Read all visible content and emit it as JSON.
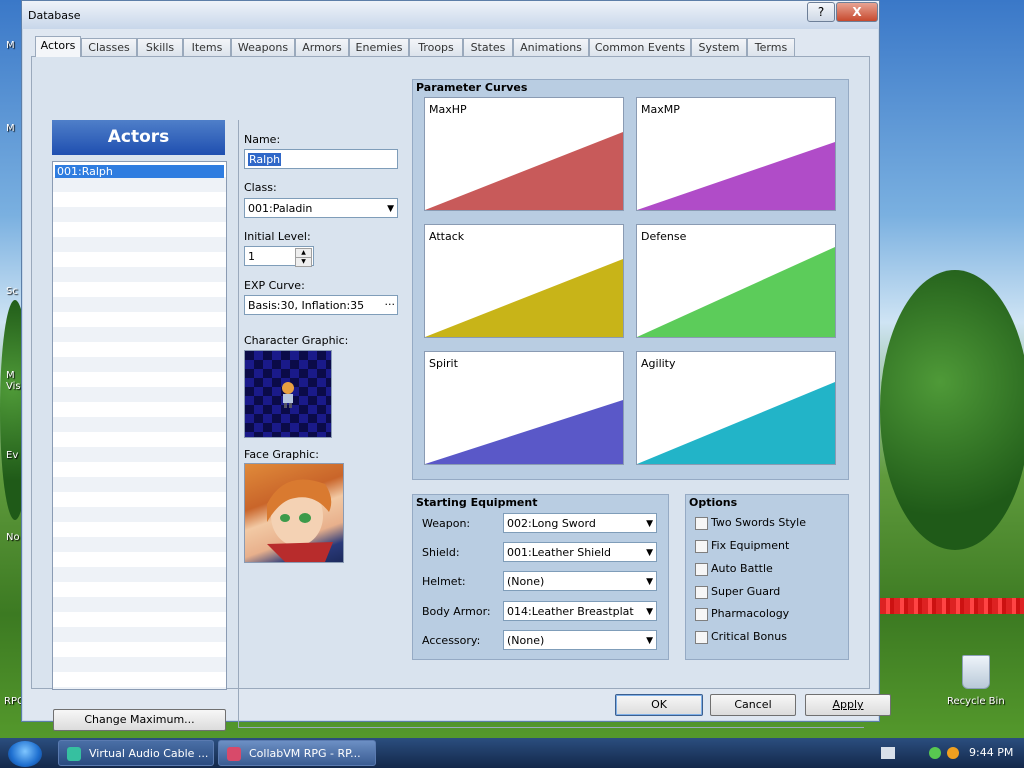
{
  "desktop": {
    "recycle_bin_label": "Recycle Bin",
    "edge_labels": [
      "M",
      "M",
      "Sc",
      "M",
      "Vis",
      "Ev",
      "No",
      "RPC"
    ]
  },
  "window": {
    "title": "Database",
    "help_label": "?",
    "close_label": "X"
  },
  "tabs": [
    {
      "label": "Actors",
      "active": true
    },
    {
      "label": "Classes"
    },
    {
      "label": "Skills"
    },
    {
      "label": "Items"
    },
    {
      "label": "Weapons"
    },
    {
      "label": "Armors"
    },
    {
      "label": "Enemies"
    },
    {
      "label": "Troops"
    },
    {
      "label": "States"
    },
    {
      "label": "Animations"
    },
    {
      "label": "Common Events"
    },
    {
      "label": "System"
    },
    {
      "label": "Terms"
    }
  ],
  "actors_list": {
    "header": "Actors",
    "items": [
      "001:Ralph"
    ],
    "change_max_label": "Change Maximum..."
  },
  "actor": {
    "name_label": "Name:",
    "name_value": "Ralph",
    "class_label": "Class:",
    "class_value": "001:Paladin",
    "level_label": "Initial Level:",
    "level_value": "1",
    "exp_label": "EXP Curve:",
    "exp_value": "Basis:30, Inflation:35",
    "character_label": "Character Graphic:",
    "face_label": "Face Graphic:"
  },
  "parameter_curves": {
    "title": "Parameter Curves",
    "curves": [
      {
        "label": "MaxHP",
        "color": "#c85a5a"
      },
      {
        "label": "MaxMP",
        "color": "#b04cc8"
      },
      {
        "label": "Attack",
        "color": "#c8b418"
      },
      {
        "label": "Defense",
        "color": "#5ccc5a"
      },
      {
        "label": "Spirit",
        "color": "#5a58c8"
      },
      {
        "label": "Agility",
        "color": "#22b4c8"
      }
    ]
  },
  "equipment": {
    "title": "Starting Equipment",
    "slots": [
      {
        "label": "Weapon:",
        "value": "002:Long Sword"
      },
      {
        "label": "Shield:",
        "value": "001:Leather Shield"
      },
      {
        "label": "Helmet:",
        "value": "(None)"
      },
      {
        "label": "Body Armor:",
        "value": "014:Leather Breastplat"
      },
      {
        "label": "Accessory:",
        "value": "(None)"
      }
    ]
  },
  "options": {
    "title": "Options",
    "items": [
      "Two Swords Style",
      "Fix Equipment",
      "Auto Battle",
      "Super Guard",
      "Pharmacology",
      "Critical Bonus"
    ]
  },
  "buttons": {
    "ok": "OK",
    "cancel": "Cancel",
    "apply": "Apply"
  },
  "taskbar": {
    "tasks": [
      "Virtual Audio Cable ...",
      "CollabVM RPG - RP..."
    ],
    "clock": "9:44 PM"
  }
}
